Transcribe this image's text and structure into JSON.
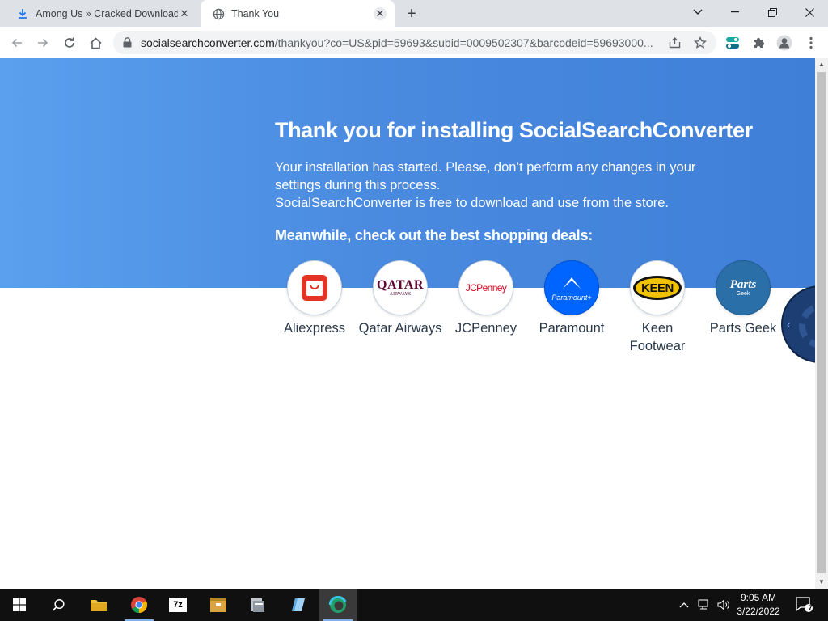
{
  "browser": {
    "tabs": [
      {
        "title": "Among Us » Cracked Download |",
        "active": false
      },
      {
        "title": "Thank You",
        "active": true
      }
    ],
    "address": {
      "domain": "socialsearchconverter.com",
      "path": "/thankyou?co=US&pid=59693&subid=0009502307&barcodeid=59693000..."
    }
  },
  "page": {
    "headline": "Thank you for installing SocialSearchConverter",
    "paragraph_line1": "Your installation has started. Please, don’t perform any changes in your settings during this process.",
    "paragraph_line2": "SocialSearchConverter is free to download and use from the store.",
    "subheading": "Meanwhile, check out the best shopping deals:",
    "deals": [
      {
        "label": "Aliexpress"
      },
      {
        "label": "Qatar Airways",
        "logo_text": "QATAR",
        "logo_sub": "AIRWAYS"
      },
      {
        "label": "JCPenney",
        "logo_text": "JCPenney"
      },
      {
        "label": "Paramount",
        "logo_text": "Paramount+"
      },
      {
        "label": "Keen Footwear",
        "logo_text": "KEEN"
      },
      {
        "label": "Parts Geek",
        "logo_text": "Parts",
        "logo_sub": "Geek"
      }
    ]
  },
  "taskbar": {
    "time": "9:05 AM",
    "date": "3/22/2022",
    "notification_count": "7",
    "sevenzip_label": "7z"
  },
  "colors": {
    "hero_start": "#5aa0ee",
    "hero_end": "#3f7fd8",
    "aliexpress": "#e43225",
    "qatar": "#5c0632",
    "jcpenney": "#d6001c",
    "paramount": "#0064ff"
  }
}
